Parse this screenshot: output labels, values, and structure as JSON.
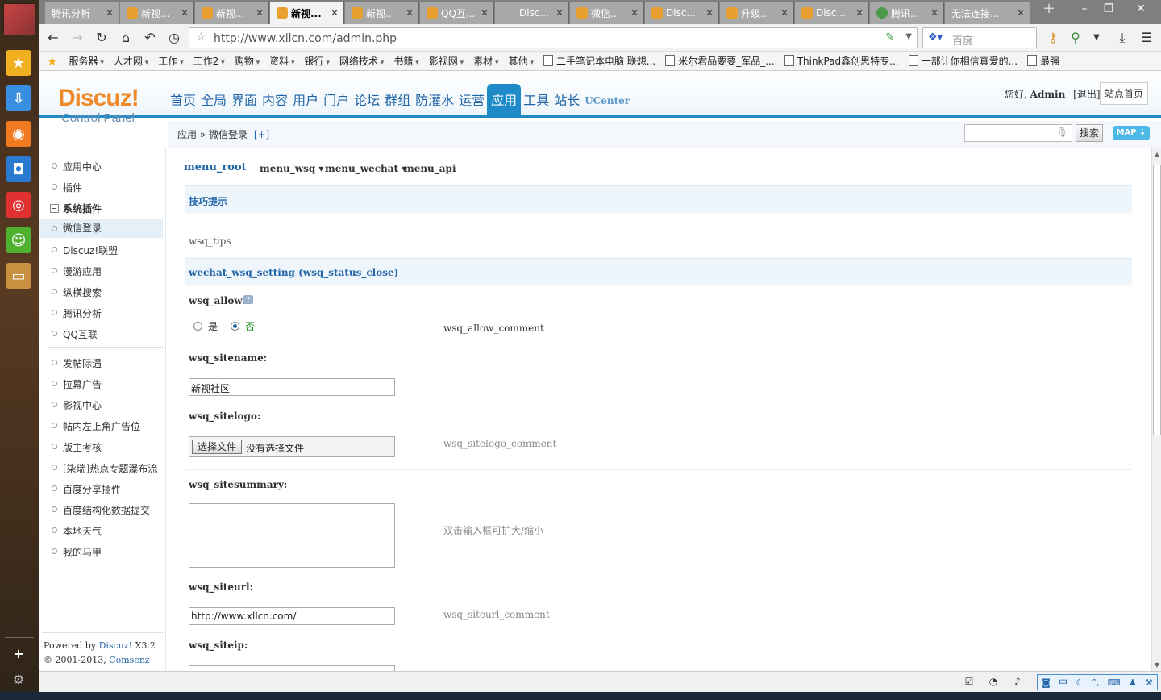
{
  "browser": {
    "tabs": [
      {
        "label": "腾讯分析",
        "active": false
      },
      {
        "label": "新视...",
        "active": false
      },
      {
        "label": "新视...",
        "active": false
      },
      {
        "label": "新视...",
        "active": true
      },
      {
        "label": "新视...",
        "active": false
      },
      {
        "label": "QQ互...",
        "active": false
      },
      {
        "label": "Disc...",
        "active": false
      },
      {
        "label": "微信...",
        "active": false
      },
      {
        "label": "Disc...",
        "active": false
      },
      {
        "label": "升级...",
        "active": false
      },
      {
        "label": "Disc...",
        "active": false
      },
      {
        "label": "腾讯...",
        "active": false
      },
      {
        "label": "无法连接...",
        "active": false
      }
    ],
    "url": "http://www.xllcn.com/admin.php",
    "search_placeholder": "百度",
    "bookmarks": [
      {
        "label": "服务器",
        "type": "folder"
      },
      {
        "label": "人才网",
        "type": "folder"
      },
      {
        "label": "工作",
        "type": "folder"
      },
      {
        "label": "工作2",
        "type": "folder"
      },
      {
        "label": "购物",
        "type": "folder"
      },
      {
        "label": "资料",
        "type": "folder"
      },
      {
        "label": "银行",
        "type": "folder"
      },
      {
        "label": "网络技术",
        "type": "folder"
      },
      {
        "label": "书籍",
        "type": "folder"
      },
      {
        "label": "影视网",
        "type": "folder"
      },
      {
        "label": "素材",
        "type": "folder"
      },
      {
        "label": "其他",
        "type": "folder"
      },
      {
        "label": "二手笔记本电脑 联想...",
        "type": "page"
      },
      {
        "label": "米尔君品要要_军品_...",
        "type": "page"
      },
      {
        "label": "ThinkPad鑫创思特专...",
        "type": "page"
      },
      {
        "label": "一部让你相信真爱的...",
        "type": "page"
      },
      {
        "label": "最强",
        "type": "page"
      }
    ]
  },
  "header": {
    "logo_main": "Discuz!",
    "logo_sub": "Control Panel",
    "nav": [
      "首页",
      "全局",
      "界面",
      "内容",
      "用户",
      "门户",
      "论坛",
      "群组",
      "防灌水",
      "运营",
      "应用",
      "工具",
      "站长",
      "UCenter"
    ],
    "active_nav": "应用",
    "hello_prefix": "您好,",
    "user": "Admin",
    "logout": "[退出]",
    "site_home": "站点首页"
  },
  "subheader": {
    "crumb": "应用 » 微信登录",
    "expand": "[+]",
    "search_button": "搜索",
    "map_button": "MAP ⇣"
  },
  "sidebar": {
    "items_top": [
      "应用中心",
      "插件"
    ],
    "group": "系统插件",
    "items_group": [
      "微信登录",
      "Discuz!联盟",
      "漫游应用",
      "纵横搜索",
      "腾讯分析",
      "QQ互联"
    ],
    "current": "微信登录",
    "items_plugins": [
      "发帖际遇",
      "拉幕广告",
      "影视中心",
      "帖内左上角广告位",
      "版主考核",
      "[柒瑞]热点专题瀑布流",
      "百度分享插件",
      "百度结构化数据提交",
      "本地天气",
      "我的马甲"
    ],
    "powered_prefix": "Powered by",
    "powered_link": "Discuz!",
    "powered_version": "X3.2",
    "copyright_prefix": "© 2001-2013,",
    "copyright_link": "Comsenz Inc."
  },
  "main": {
    "submenu": {
      "root": "menu_root",
      "items": [
        "menu_wsq ▾",
        "menu_wechat ▾",
        "menu_api"
      ]
    },
    "tips_title": "技巧提示",
    "tips_text": "wsq_tips",
    "setting_title": "wechat_wsq_setting (wsq_status_close)",
    "fields": {
      "allow_label": "wsq_allow:",
      "allow_yes": "是",
      "allow_no": "否",
      "allow_value": "否",
      "allow_comment": "wsq_allow_comment",
      "sitename_label": "wsq_sitename:",
      "sitename_value": "新视社区",
      "sitelogo_label": "wsq_sitelogo:",
      "sitelogo_button": "选择文件",
      "sitelogo_status": "没有选择文件",
      "sitelogo_comment": "wsq_sitelogo_comment",
      "sitesummary_label": "wsq_sitesummary:",
      "sitesummary_comment": "双击输入框可扩大/缩小",
      "siteurl_label": "wsq_siteurl:",
      "siteurl_value": "http://www.xllcn.com/",
      "siteurl_comment": "wsq_siteurl_comment",
      "siteip_label": "wsq_siteip:"
    }
  },
  "colors": {
    "accent": "#1e8ac8",
    "link": "#2366a8",
    "logo": "#f0892a"
  }
}
